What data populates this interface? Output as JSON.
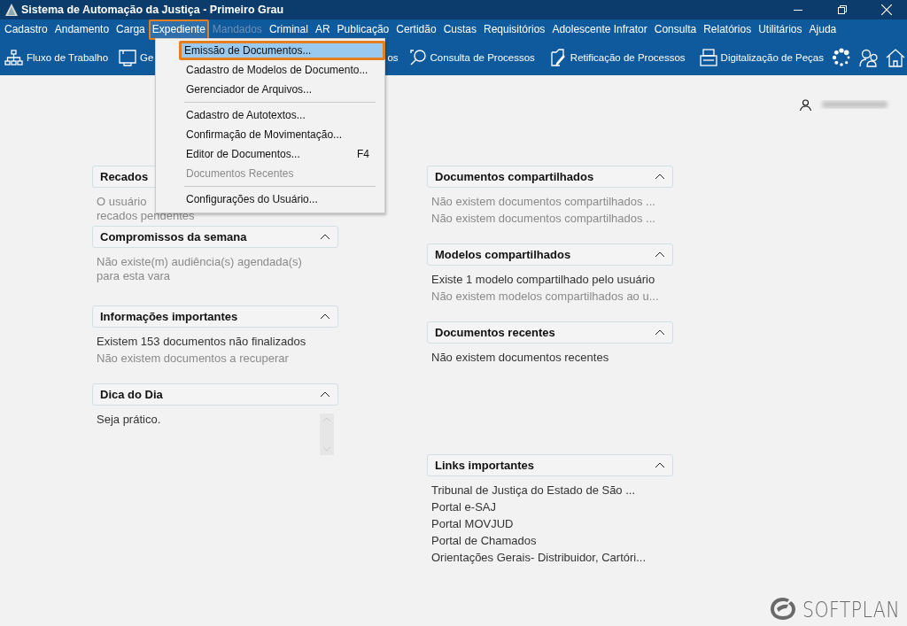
{
  "window": {
    "title": "Sistema de Automação da Justiça - Primeiro Grau"
  },
  "menu_bar": [
    {
      "label": "Cadastro",
      "selected": false,
      "disabled": false
    },
    {
      "label": "Andamento",
      "selected": false,
      "disabled": false
    },
    {
      "label": "Carga",
      "selected": false,
      "disabled": false
    },
    {
      "label": "Expediente",
      "selected": true,
      "disabled": false,
      "highlighted": true
    },
    {
      "label": "Mandados",
      "selected": false,
      "disabled": true
    },
    {
      "label": "Criminal",
      "selected": false,
      "disabled": false
    },
    {
      "label": "AR",
      "selected": false,
      "disabled": false
    },
    {
      "label": "Publicação",
      "selected": false,
      "disabled": false
    },
    {
      "label": "Certidão",
      "selected": false,
      "disabled": false
    },
    {
      "label": "Custas",
      "selected": false,
      "disabled": false
    },
    {
      "label": "Requisitórios",
      "selected": false,
      "disabled": false
    },
    {
      "label": "Adolescente Infrator",
      "selected": false,
      "disabled": false
    },
    {
      "label": "Consulta",
      "selected": false,
      "disabled": false
    },
    {
      "label": "Relatórios",
      "selected": false,
      "disabled": false
    },
    {
      "label": "Utilitários",
      "selected": false,
      "disabled": false
    },
    {
      "label": "Ajuda",
      "selected": false,
      "disabled": false
    }
  ],
  "toolbar": [
    {
      "label": "Fluxo de Trabalho"
    },
    {
      "label": "Ge"
    },
    {
      "label": "os"
    },
    {
      "label": "Consulta de Processos"
    },
    {
      "label": "Retificação de Processos"
    },
    {
      "label": "Digitalização de Peças"
    }
  ],
  "dropdown": {
    "items": [
      {
        "kind": "item",
        "label": "Emissão de Documentos...",
        "selected": true,
        "disabled": false,
        "highlighted": true
      },
      {
        "kind": "item",
        "label": "Cadastro de Modelos de Documento...",
        "selected": false,
        "disabled": false
      },
      {
        "kind": "item",
        "label": "Gerenciador de Arquivos...",
        "selected": false,
        "disabled": false
      },
      {
        "kind": "separator"
      },
      {
        "kind": "item",
        "label": "Cadastro de Autotextos...",
        "selected": false,
        "disabled": false
      },
      {
        "kind": "item",
        "label": "Confirmação de Movimentação...",
        "selected": false,
        "disabled": false
      },
      {
        "kind": "item",
        "label": "Editor de Documentos...",
        "shortcut": "F4",
        "selected": false,
        "disabled": false
      },
      {
        "kind": "item",
        "label": "Documentos Recentes",
        "selected": false,
        "disabled": true
      },
      {
        "kind": "separator"
      },
      {
        "kind": "item",
        "label": "Configurações do Usuário...",
        "selected": false,
        "disabled": false
      }
    ]
  },
  "left_panels": [
    {
      "title": "Recados",
      "lines": [
        {
          "text": "O usuário",
          "muted": true
        },
        {
          "text": "recados pendentes",
          "muted": true
        }
      ]
    },
    {
      "title": "Compromissos da semana",
      "expanded": true,
      "lines": [
        {
          "text": "Não existe(m) audiência(s) agendada(s) para esta vara",
          "muted": true
        }
      ]
    },
    {
      "title": "Informações importantes",
      "expanded": true,
      "lines": [
        {
          "text": "Existem 153 documentos não finalizados",
          "muted": false
        },
        {
          "text": "Não existem documentos a recuperar",
          "muted": true
        }
      ]
    },
    {
      "title": "Dica do Dia",
      "expanded": true,
      "scrollbar": true,
      "lines": [
        {
          "text": "Seja prático.",
          "muted": false
        }
      ]
    }
  ],
  "right_panels": [
    {
      "title": "Documentos compartilhados",
      "expanded": true,
      "lines": [
        {
          "text": "Não existem documentos compartilhados ...",
          "muted": true
        },
        {
          "text": "Não existem documentos compartilhados ...",
          "muted": true
        }
      ]
    },
    {
      "title": "Modelos compartilhados",
      "expanded": true,
      "lines": [
        {
          "text": "Existe 1 modelo compartilhado pelo usuário",
          "muted": false
        },
        {
          "text": "Não existem modelos compartilhados ao u...",
          "muted": true
        }
      ]
    },
    {
      "title": "Documentos recentes",
      "expanded": true,
      "lines": [
        {
          "text": "Não existem documentos recentes",
          "muted": false
        }
      ]
    },
    {
      "title": "Links importantes",
      "expanded": true,
      "lines": [
        {
          "text": "Tribunal de Justiça do Estado de São ...",
          "muted": false
        },
        {
          "text": "Portal e-SAJ",
          "muted": false
        },
        {
          "text": "Portal MOVJUD",
          "muted": false
        },
        {
          "text": "Portal de Chamados",
          "muted": false
        },
        {
          "text": "Orientações Gerais- Distribuidor, Cartóri...",
          "muted": false
        }
      ]
    }
  ],
  "logo": {
    "text": "SOFTPLAN"
  }
}
